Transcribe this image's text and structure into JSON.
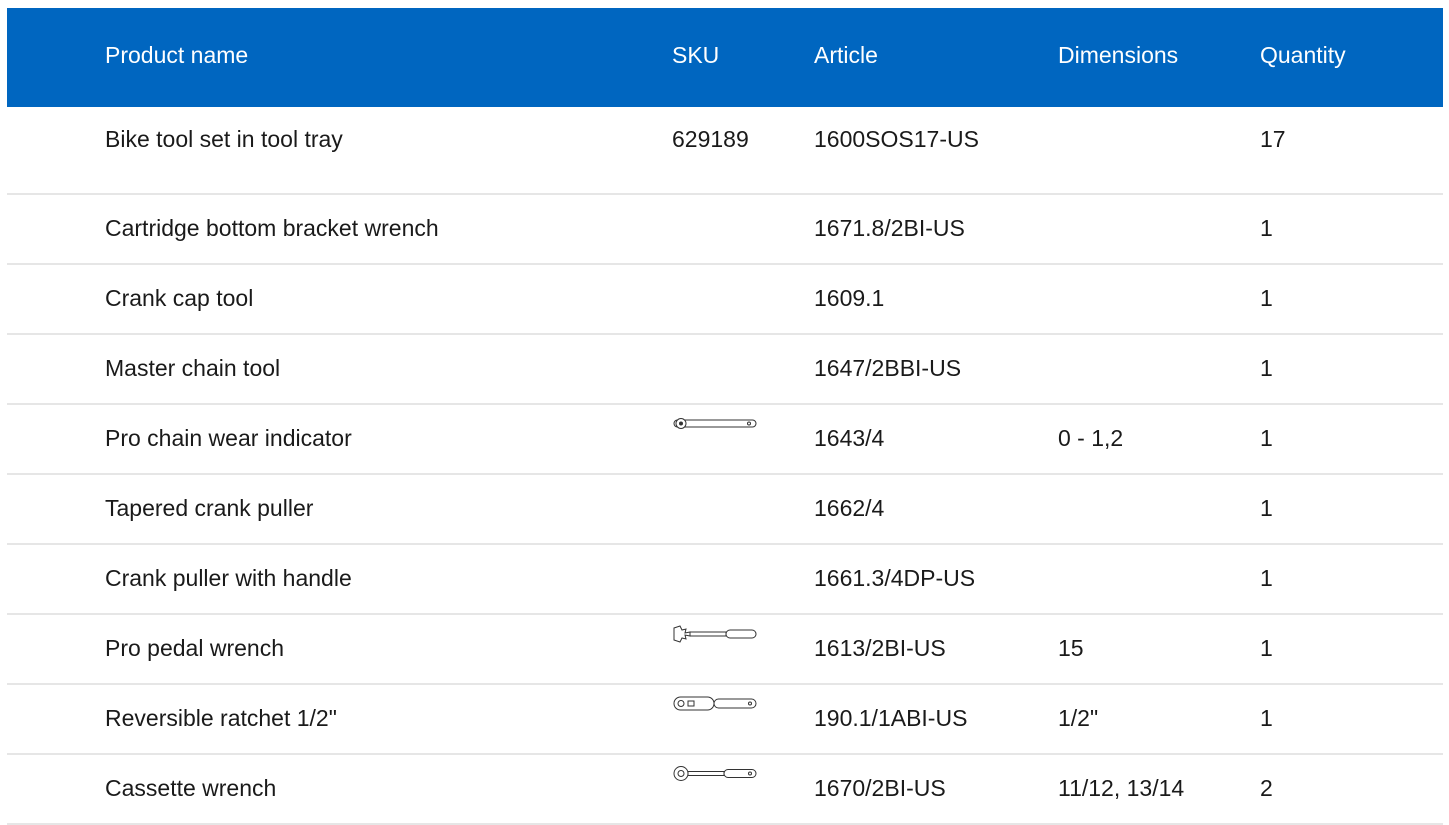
{
  "headers": {
    "name": "Product name",
    "sku": "SKU",
    "article": "Article",
    "dimensions": "Dimensions",
    "quantity": "Quantity"
  },
  "rows": [
    {
      "name": "Bike tool set in tool tray",
      "sku": "629189",
      "article": "1600SOS17-US",
      "dimensions": "",
      "quantity": "17",
      "icon": ""
    },
    {
      "name": "Cartridge bottom bracket wrench",
      "sku": "",
      "article": "1671.8/2BI-US",
      "dimensions": "",
      "quantity": "1",
      "icon": ""
    },
    {
      "name": "Crank cap tool",
      "sku": "",
      "article": "1609.1",
      "dimensions": "",
      "quantity": "1",
      "icon": ""
    },
    {
      "name": "Master chain tool",
      "sku": "",
      "article": "1647/2BBI-US",
      "dimensions": "",
      "quantity": "1",
      "icon": ""
    },
    {
      "name": "Pro chain wear indicator",
      "sku": "",
      "article": "1643/4",
      "dimensions": "0 - 1,2",
      "quantity": "1",
      "icon": "chain-wear-indicator-icon"
    },
    {
      "name": "Tapered crank puller",
      "sku": "",
      "article": "1662/4",
      "dimensions": "",
      "quantity": "1",
      "icon": ""
    },
    {
      "name": "Crank puller with handle",
      "sku": "",
      "article": "1661.3/4DP-US",
      "dimensions": "",
      "quantity": "1",
      "icon": ""
    },
    {
      "name": "Pro pedal wrench",
      "sku": "",
      "article": "1613/2BI-US",
      "dimensions": "15",
      "quantity": "1",
      "icon": "pedal-wrench-icon"
    },
    {
      "name": "Reversible ratchet 1/2\"",
      "sku": "",
      "article": "190.1/1ABI-US",
      "dimensions": "1/2\"",
      "quantity": "1",
      "icon": "ratchet-icon"
    },
    {
      "name": "Cassette wrench",
      "sku": "",
      "article": "1670/2BI-US",
      "dimensions": "11/12, 13/14",
      "quantity": "2",
      "icon": "cassette-wrench-icon"
    }
  ]
}
